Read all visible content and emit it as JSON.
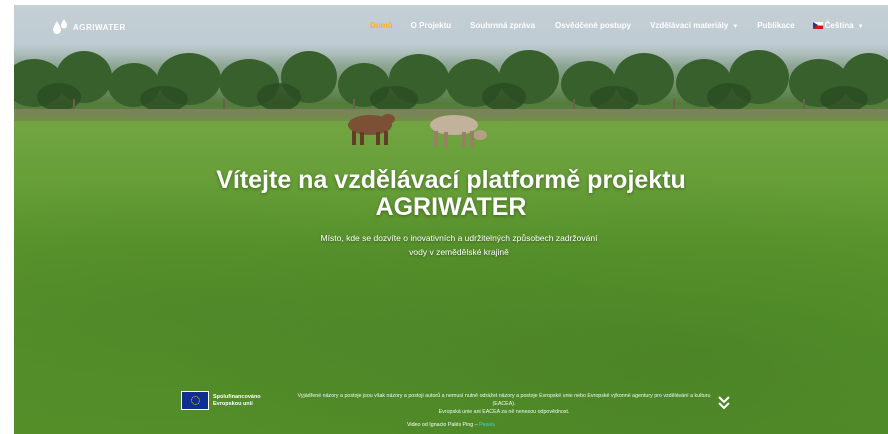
{
  "brand": {
    "logo_text": "AGRIWATER"
  },
  "nav": {
    "items": [
      {
        "label": "Domů",
        "active": true,
        "caret": false
      },
      {
        "label": "O Projektu",
        "active": false,
        "caret": false
      },
      {
        "label": "Souhrnná zpráva",
        "active": false,
        "caret": false
      },
      {
        "label": "Osvědčené postupy",
        "active": false,
        "caret": false
      },
      {
        "label": "Vzdělávací materiály",
        "active": false,
        "caret": true
      },
      {
        "label": "Publikace",
        "active": false,
        "caret": false
      }
    ],
    "language": {
      "label": "Čeština",
      "flag": "czech-flag-icon"
    }
  },
  "hero": {
    "title_line1": "Vítejte na vzdělávací platformě projektu",
    "title_line2": "AGRIWATER",
    "subtitle_line1": "Místo, kde se dozvíte o inovativních a udržitelných způsobech zadržování",
    "subtitle_line2": "vody v zemědělské krajině"
  },
  "footer": {
    "eu_label_line1": "Spolufinancováno",
    "eu_label_line2": "Evropskou unií",
    "disclaimer_line1": "Vyjádřené názory a postoje jsou však názory a postoji autorů a nemusí nutně odrážet názory a postoje Evropské unie nebo Evropské výkonné agentury pro vzdělávání a kulturu (EACEA).",
    "disclaimer_line2": "Evropská unie ani EACEA za ně nenesou odpovědnost.",
    "video_credit_prefix": "Video od Ignacio Palés Ping –",
    "video_credit_link": "Pexels"
  },
  "colors": {
    "active_nav": "#ffb11f",
    "link": "#3fd2d8"
  }
}
